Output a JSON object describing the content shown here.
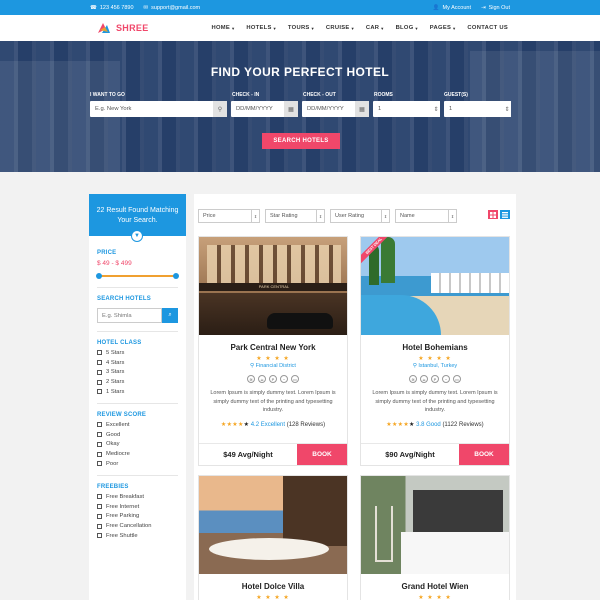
{
  "topbar": {
    "phone": "123 456 7890",
    "email": "support@gmail.com",
    "account": "My Account",
    "signout": "Sign Out"
  },
  "brand": {
    "name": "SHREE"
  },
  "menu": [
    {
      "label": "HOME",
      "caret": true
    },
    {
      "label": "HOTELS",
      "caret": true
    },
    {
      "label": "TOURS",
      "caret": true
    },
    {
      "label": "CRUISE",
      "caret": true
    },
    {
      "label": "CAR",
      "caret": true
    },
    {
      "label": "BLOG",
      "caret": true
    },
    {
      "label": "PAGES",
      "caret": true
    },
    {
      "label": "CONTACT US",
      "caret": false
    }
  ],
  "hero": {
    "title": "FIND YOUR PERFECT HOTEL",
    "labels": {
      "where": "I WANT TO GO",
      "checkin": "CHECK - IN",
      "checkout": "CHECK - OUT",
      "rooms": "ROOMS",
      "guests": "GUEST(S)"
    },
    "where_placeholder": "E.g. New York",
    "checkin_placeholder": "DD/MM/YYYY",
    "checkout_placeholder": "DD/MM/YYYY",
    "rooms_value": "1",
    "guests_value": "1",
    "search_label": "SEARCH HOTELS"
  },
  "sidebar": {
    "result_text": "22 Result Found Matching Your Search.",
    "price_title": "PRICE",
    "price_range": "$ 49 - $ 499",
    "search_title": "SEARCH HOTELS",
    "search_placeholder": "E.g. Shimla",
    "hotel_class_title": "HOTEL CLASS",
    "hotel_class": [
      "5 Stars",
      "4 Stars",
      "3 Stars",
      "2 Stars",
      "1 Stars"
    ],
    "review_title": "REVIEW SCORE",
    "review": [
      "Excellent",
      "Good",
      "Okay",
      "Mediocre",
      "Poor"
    ],
    "freebies_title": "FREEBIES",
    "freebies": [
      "Free Breakfast",
      "Free Internet",
      "Free Parking",
      "Free Cancellation",
      "Free Shuttle"
    ]
  },
  "filters": [
    {
      "label": "Price"
    },
    {
      "label": "Star Rating"
    },
    {
      "label": "User Rating"
    },
    {
      "label": "Name"
    }
  ],
  "cards": [
    {
      "name": "Park Central New York",
      "stars": "★ ★ ★ ★",
      "location": "Financial District",
      "desc": "Lorem Ipsum is simply dummy text. Lorem Ipsum is simply dummy text of the printing and typesetting industry.",
      "rating_score": "4.2 Excellent",
      "reviews": "(128 Reviews)",
      "price": "$49 Avg/Night",
      "book": "BOOK",
      "sign": "PARK CENTRAL"
    },
    {
      "name": "Hotel Bohemians",
      "stars": "★ ★ ★ ★",
      "location": "Istanbul, Turkey",
      "desc": "Lorem Ipsum is simply dummy text. Lorem Ipsum is simply dummy text of the printing and typesetting industry.",
      "rating_score": "3.8 Good",
      "reviews": "(1122 Reviews)",
      "price": "$90 Avg/Night",
      "book": "BOOK",
      "ribbon": "BEST DEAL"
    },
    {
      "name": "Hotel Dolce Villa",
      "stars": "★ ★ ★ ★"
    },
    {
      "name": "Grand Hotel Wien",
      "stars": "★ ★ ★ ★"
    }
  ],
  "icons": {
    "phone": "phone-icon",
    "email": "mail-icon",
    "account": "user-icon",
    "signout": "signout-icon",
    "marker": "map-marker-icon",
    "calendar": "calendar-icon",
    "search": "search-icon",
    "filter": "filter-icon",
    "grid": "grid-view-icon",
    "list": "list-view-icon"
  },
  "colors": {
    "primary": "#1d97e0",
    "accent": "#f0476a",
    "star": "#f5a623"
  }
}
